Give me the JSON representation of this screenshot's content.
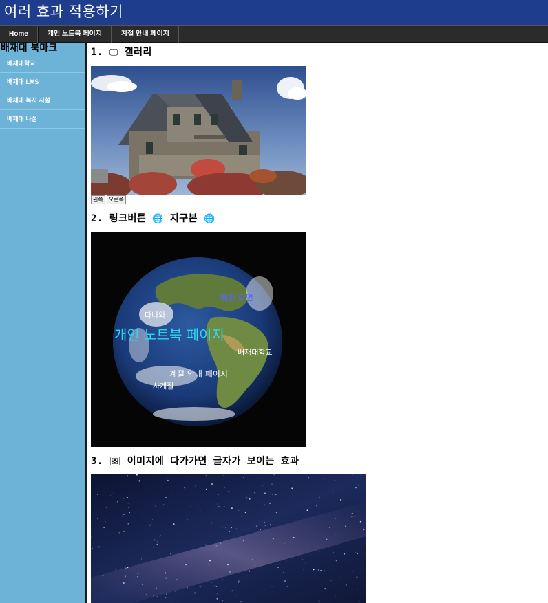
{
  "header": {
    "title": "여러 효과 적용하기"
  },
  "nav": {
    "items": [
      "Home",
      "개인 노트북 페이지",
      "계절 안내 페이지"
    ]
  },
  "sidebar": {
    "title": "배재대 북마크",
    "items": [
      "배재대학교",
      "배재대 LMS",
      "배재대 복지 시설",
      "배재대 나섬"
    ]
  },
  "sections": {
    "gallery": {
      "number": "1.",
      "icon": "🖵",
      "title": "갤러리",
      "btn_left": "왼쪽",
      "btn_right": "오른쪽"
    },
    "linkbutton": {
      "number": "2.",
      "title": "링크버튼",
      "icon": "🌐",
      "subtitle": "지구본",
      "icon2": "🌐"
    },
    "hover": {
      "number": "3.",
      "icon": "🖼",
      "title": "이미지에 다가가면 글자가 보이는 효과"
    }
  },
  "earth_links": {
    "main": "메인 화면",
    "dana": "다나와",
    "notebook": "개인 노트북 페이지",
    "pcu": "배재대학교",
    "season_guide": "계절 안내 페이지",
    "four_seasons": "사계절"
  },
  "colors": {
    "header_bg": "#1e3d8c",
    "nav_bg": "#2b2b2b",
    "sidebar_bg": "#6db3d8"
  }
}
